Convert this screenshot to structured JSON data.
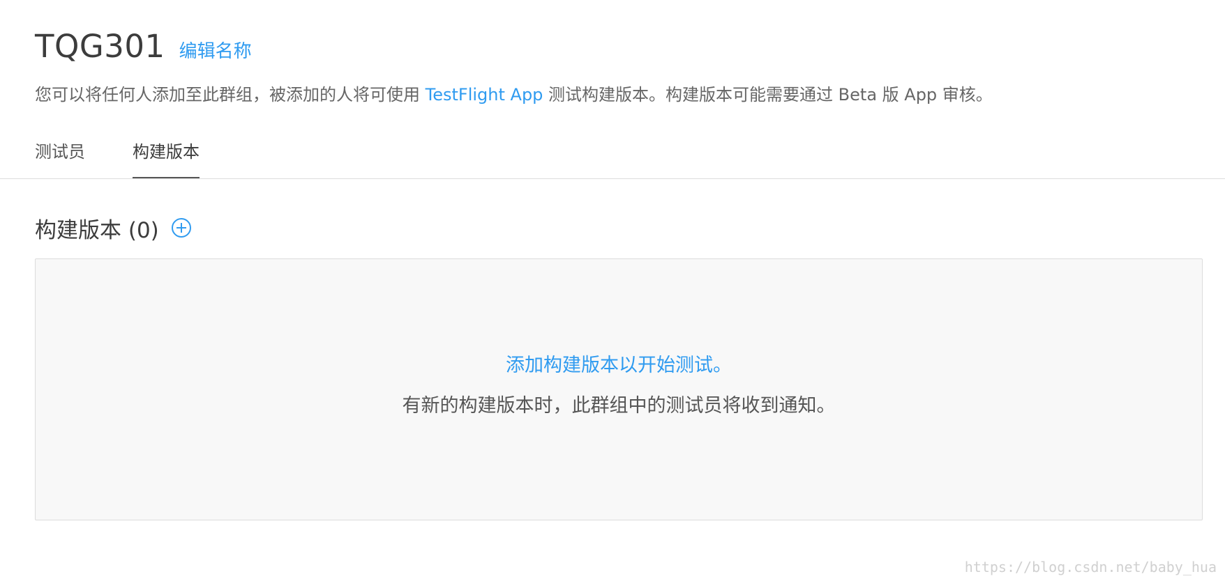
{
  "header": {
    "group_name": "TQG301",
    "edit_label": "编辑名称",
    "description_before": "您可以将任何人添加至此群组，被添加的人将可使用 ",
    "description_link": "TestFlight App",
    "description_after": " 测试构建版本。构建版本可能需要通过 Beta 版 App 审核。"
  },
  "tabs": [
    {
      "label": "测试员",
      "active": false
    },
    {
      "label": "构建版本",
      "active": true
    }
  ],
  "builds_section": {
    "title": "构建版本 (0)",
    "add_icon": "plus-circle-icon",
    "empty_link": "添加构建版本以开始测试。",
    "empty_note": "有新的构建版本时，此群组中的测试员将收到通知。"
  },
  "watermark": "https://blog.csdn.net/baby_hua",
  "colors": {
    "accent": "#2f9bf0",
    "text": "#333333",
    "panel_bg": "#f8f8f8"
  }
}
